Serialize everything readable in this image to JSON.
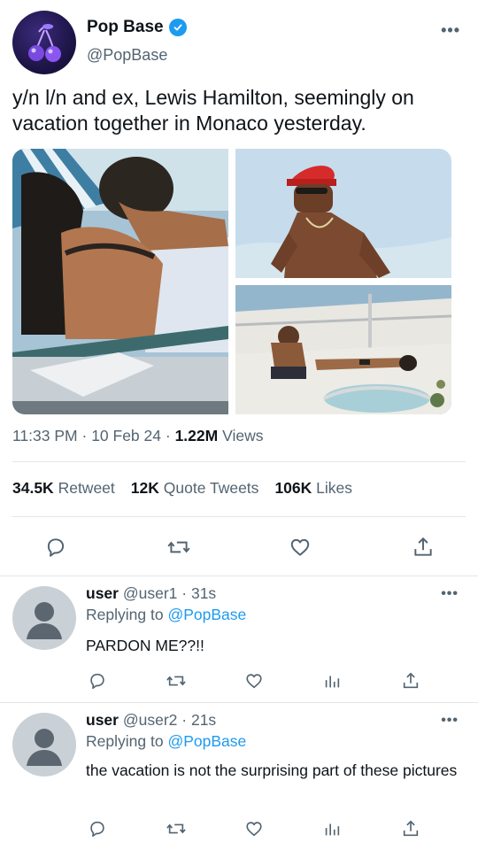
{
  "tweet": {
    "author_name": "Pop Base",
    "author_handle": "@PopBase",
    "more_icon": "more-icon",
    "text": "y/n l/n and ex, Lewis Hamilton, seemingly on vacation together in Monaco yesterday.",
    "time": "11:33 PM",
    "date": "10 Feb 24",
    "views_count": "1.22M",
    "views_label": "Views",
    "retweets_count": "34.5K",
    "retweets_label": "Retweet",
    "quotes_count": "12K",
    "quotes_label": "Quote Tweets",
    "likes_count": "106K",
    "likes_label": "Likes"
  },
  "replies": [
    {
      "name": "user",
      "handle": "@user1",
      "time": "31s",
      "replying_label": "Replying to",
      "replying_to": "@PopBase",
      "text": "PARDON ME??!!"
    },
    {
      "name": "user",
      "handle": "@user2",
      "time": "21s",
      "replying_label": "Replying to",
      "replying_to": "@PopBase",
      "text": "the vacation is not the surprising part of these pictures"
    }
  ],
  "colors": {
    "accent": "#1d9bf0",
    "text": "#0f1419",
    "muted": "#536471",
    "divider": "#e3e6e9"
  }
}
